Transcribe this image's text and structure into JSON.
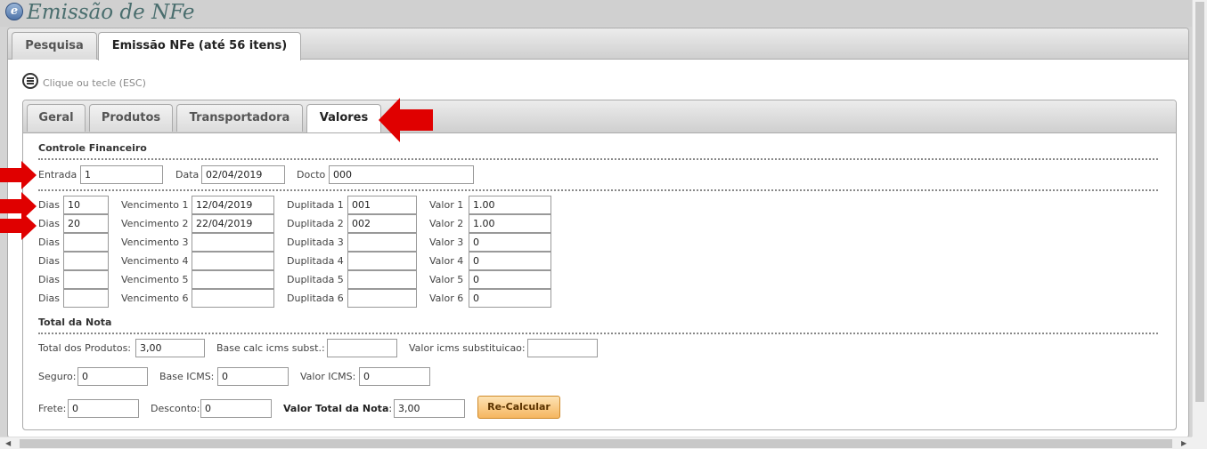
{
  "app": {
    "title": "Emissão de NFe",
    "logo_icon": "nfe-logo-icon"
  },
  "outer_tabs": [
    {
      "label": "Pesquisa"
    },
    {
      "label": "Emissão NFe (até 56 itens)"
    }
  ],
  "menu": {
    "hint": "Clique ou tecle (ESC)",
    "icon": "menu-icon"
  },
  "inner_tabs": [
    {
      "label": "Geral"
    },
    {
      "label": "Produtos"
    },
    {
      "label": "Transportadora"
    },
    {
      "label": "Valores"
    }
  ],
  "controle": {
    "title": "Controle Financeiro",
    "entrada_label": "Entrada",
    "entrada_value": "1",
    "data_label": "Data",
    "data_value": "02/04/2019",
    "docto_label": "Docto",
    "docto_value": "000"
  },
  "parcelas": [
    {
      "dias_label": "Dias",
      "dias": "10",
      "venc_label": "Vencimento 1",
      "venc": "12/04/2019",
      "dup_label": "Duplitada 1",
      "dup": "001",
      "valor_label": "Valor 1",
      "valor": "1.00"
    },
    {
      "dias_label": "Dias",
      "dias": "20",
      "venc_label": "Vencimento 2",
      "venc": "22/04/2019",
      "dup_label": "Duplitada 2",
      "dup": "002",
      "valor_label": "Valor 2",
      "valor": "1.00"
    },
    {
      "dias_label": "Dias",
      "dias": "",
      "venc_label": "Vencimento 3",
      "venc": "",
      "dup_label": "Duplitada 3",
      "dup": "",
      "valor_label": "Valor 3",
      "valor": "0"
    },
    {
      "dias_label": "Dias",
      "dias": "",
      "venc_label": "Vencimento 4",
      "venc": "",
      "dup_label": "Duplitada 4",
      "dup": "",
      "valor_label": "Valor 4",
      "valor": "0"
    },
    {
      "dias_label": "Dias",
      "dias": "",
      "venc_label": "Vencimento 5",
      "venc": "",
      "dup_label": "Duplitada 5",
      "dup": "",
      "valor_label": "Valor 5",
      "valor": "0"
    },
    {
      "dias_label": "Dias",
      "dias": "",
      "venc_label": "Vencimento 6",
      "venc": "",
      "dup_label": "Duplitada 6",
      "dup": "",
      "valor_label": "Valor 6",
      "valor": "0"
    }
  ],
  "total": {
    "title": "Total da Nota",
    "total_produtos_label": "Total dos Produtos:",
    "total_produtos": "3,00",
    "base_subst_label": "Base calc icms subst.:",
    "base_subst": "",
    "valor_subst_label": "Valor icms substituicao:",
    "valor_subst": "",
    "seguro_label": "Seguro:",
    "seguro": "0",
    "base_icms_label": "Base ICMS:",
    "base_icms": "0",
    "valor_icms_label": "Valor ICMS:",
    "valor_icms": "0",
    "frete_label": "Frete:",
    "frete": "0",
    "desconto_label": "Desconto:",
    "desconto": "0",
    "valor_total_label": "Valor Total da Nota",
    "valor_total_colon": ":",
    "valor_total": "3,00",
    "recalc_label": "Re-Calcular"
  },
  "colors": {
    "arrow": "#e00000",
    "button": "#f5b660",
    "title": "#4a6e6e"
  }
}
